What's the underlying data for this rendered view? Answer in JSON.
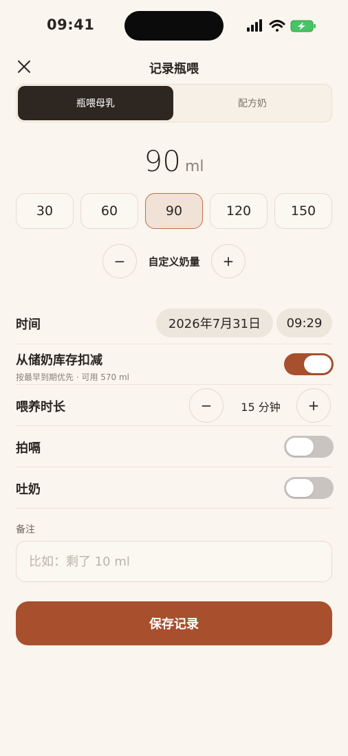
{
  "status_bar": {
    "time": "09:41"
  },
  "header": {
    "title": "记录瓶喂",
    "close_icon": "close-icon"
  },
  "segment": {
    "active": "瓶喂母乳",
    "inactive": "配方奶"
  },
  "amount": {
    "value": "90",
    "unit": "ml"
  },
  "presets": [
    "30",
    "60",
    "90",
    "120",
    "150"
  ],
  "selected_preset": "90",
  "custom": {
    "label": "自定义奶量",
    "minus": "−",
    "plus": "+"
  },
  "time_row": {
    "label": "时间",
    "date": "2026年7月31日",
    "time": "09:29"
  },
  "deduct_row": {
    "label": "从储奶库存扣减",
    "sub": "按最早到期优先 · 可用 570 ml",
    "on": true
  },
  "duration_row": {
    "label": "喂养时长",
    "value": "15 分钟",
    "minus": "−",
    "plus": "+"
  },
  "burp_row": {
    "label": "拍嗝",
    "on": false
  },
  "spit_row": {
    "label": "吐奶",
    "on": false
  },
  "notes": {
    "label": "备注",
    "placeholder": "比如：剩了 10 ml",
    "value": ""
  },
  "save_label": "保存记录",
  "colors": {
    "accent": "#a84f2e",
    "dark": "#2e2620",
    "background": "#faf5ee"
  }
}
